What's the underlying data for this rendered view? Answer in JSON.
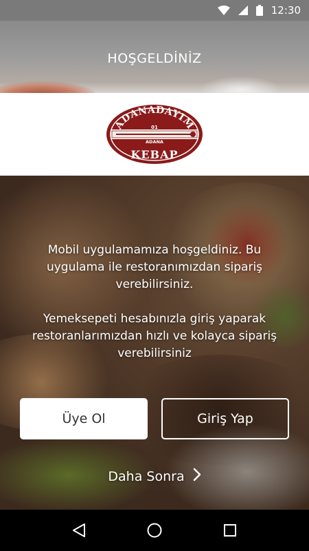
{
  "status_bar": {
    "time": "12:30",
    "icons": [
      "wifi-icon",
      "signal-icon",
      "battery-icon"
    ]
  },
  "header": {
    "title": "HOŞGELDİNİZ"
  },
  "logo": {
    "top_text": "ADANADAYIM",
    "number": "01",
    "city": "ADANA",
    "bottom_text": "KEBAP",
    "color": "#8b1a1a"
  },
  "welcome": {
    "line1": "Mobil uygulamamıza hoşgeldiniz. Bu uygulama ile restoranımızdan sipariş verebilirsiniz.",
    "line2": "Yemeksepeti hesabınızla giriş yaparak restoranlarımızdan hızlı ve kolayca sipariş verebilirsiniz"
  },
  "buttons": {
    "register": "Üye Ol",
    "login": "Giriş Yap",
    "later": "Daha Sonra"
  },
  "nav": {
    "icons": [
      "back-icon",
      "home-icon",
      "recents-icon"
    ]
  }
}
